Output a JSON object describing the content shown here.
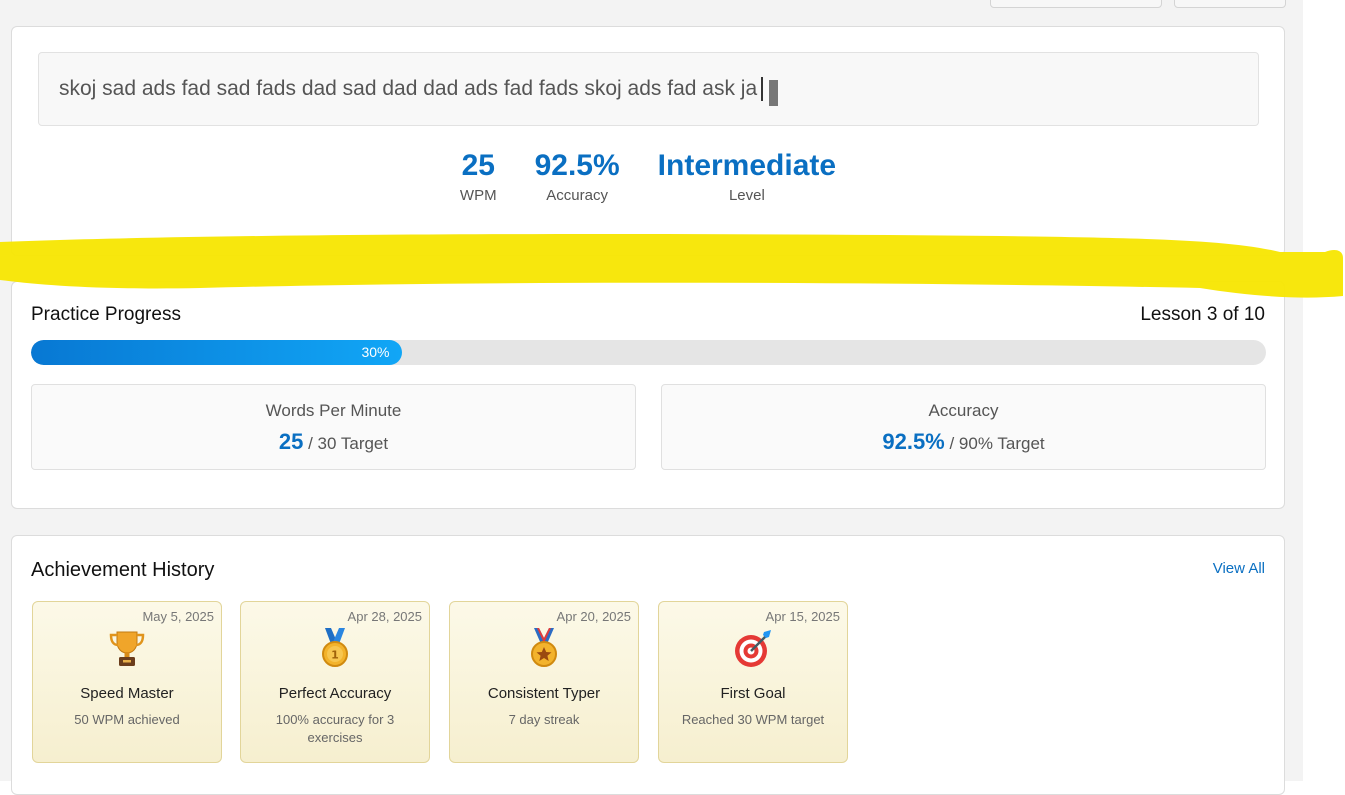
{
  "typing": {
    "text": "skoj sad ads fad sad fads dad sad dad dad ads fad fads skoj ads fad ask ja",
    "stats": [
      {
        "value": "25",
        "label": "WPM"
      },
      {
        "value": "92.5%",
        "label": "Accuracy"
      },
      {
        "value": "Intermediate",
        "label": "Level"
      }
    ]
  },
  "progress": {
    "title": "Practice Progress",
    "lesson": "Lesson 3 of 10",
    "percent_value": 30,
    "percent_label": "30%",
    "wpm": {
      "title": "Words Per Minute",
      "value": "25",
      "target": "/ 30 Target"
    },
    "accuracy": {
      "title": "Accuracy",
      "value": "92.5%",
      "target": "/ 90% Target"
    }
  },
  "achievements": {
    "title": "Achievement History",
    "view_all": "View All",
    "items": [
      {
        "date": "May 5, 2025",
        "icon": "trophy-icon",
        "name": "Speed Master",
        "desc": "50 WPM achieved"
      },
      {
        "date": "Apr 28, 2025",
        "icon": "medal-first-place-icon",
        "name": "Perfect Accuracy",
        "desc": "100% accuracy for 3 exercises"
      },
      {
        "date": "Apr 20, 2025",
        "icon": "medal-star-icon",
        "name": "Consistent Typer",
        "desc": "7 day streak"
      },
      {
        "date": "Apr 15, 2025",
        "icon": "target-dart-icon",
        "name": "First Goal",
        "desc": "Reached 30 WPM target"
      }
    ]
  },
  "colors": {
    "accent": "#0a6fc2",
    "highlight": "#f7e600",
    "achievement_bg": "#f8f3dc"
  }
}
